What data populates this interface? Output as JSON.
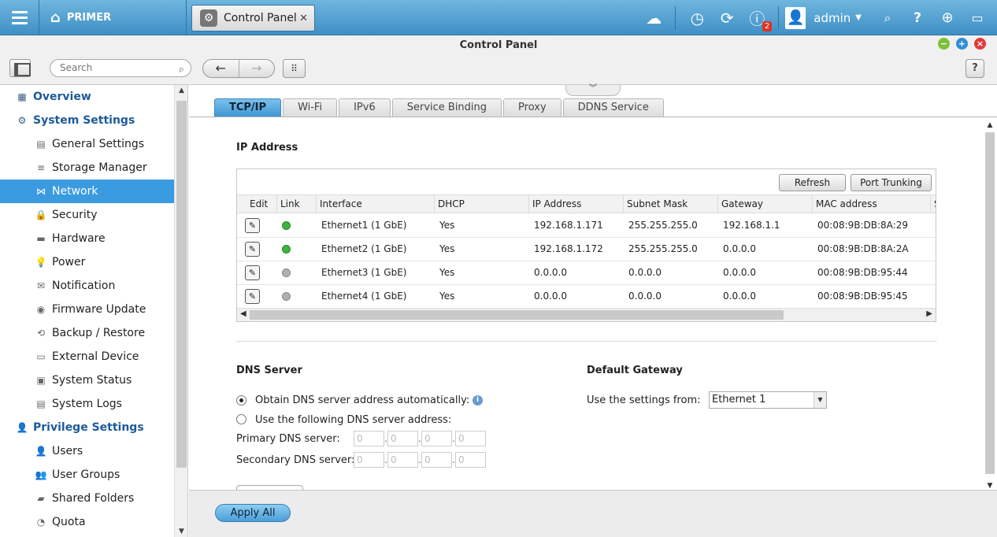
{
  "topbar": {
    "home_label": "PRIMER",
    "tab_title": "Control Panel",
    "tab_close": "✕",
    "user_name": "admin",
    "notification_count": "2"
  },
  "window": {
    "title": "Control Panel"
  },
  "toolbar": {
    "search_placeholder": "Search"
  },
  "sidebar": {
    "items": [
      {
        "label": "Overview",
        "section": true,
        "icon": "grid-icon"
      },
      {
        "label": "System Settings",
        "section": true,
        "icon": "gear-icon"
      },
      {
        "label": "General Settings",
        "icon": "settings-doc-icon"
      },
      {
        "label": "Storage Manager",
        "icon": "storage-icon"
      },
      {
        "label": "Network",
        "icon": "network-icon",
        "active": true
      },
      {
        "label": "Security",
        "icon": "lock-icon"
      },
      {
        "label": "Hardware",
        "icon": "hardware-icon"
      },
      {
        "label": "Power",
        "icon": "power-icon"
      },
      {
        "label": "Notification",
        "icon": "notification-icon"
      },
      {
        "label": "Firmware Update",
        "icon": "firmware-icon"
      },
      {
        "label": "Backup / Restore",
        "icon": "backup-icon"
      },
      {
        "label": "External Device",
        "icon": "external-device-icon"
      },
      {
        "label": "System Status",
        "icon": "monitor-icon"
      },
      {
        "label": "System Logs",
        "icon": "logs-icon"
      },
      {
        "label": "Privilege Settings",
        "section": true,
        "icon": "user-icon"
      },
      {
        "label": "Users",
        "icon": "user-icon"
      },
      {
        "label": "User Groups",
        "icon": "user-group-icon"
      },
      {
        "label": "Shared Folders",
        "icon": "folder-icon"
      },
      {
        "label": "Quota",
        "icon": "quota-icon"
      }
    ]
  },
  "tabs": [
    "TCP/IP",
    "Wi-Fi",
    "IPv6",
    "Service Binding",
    "Proxy",
    "DDNS Service"
  ],
  "ip_section": {
    "title": "IP Address",
    "refresh_label": "Refresh",
    "port_trunking_label": "Port Trunking",
    "columns": [
      "Edit",
      "Link",
      "Interface",
      "DHCP",
      "IP Address",
      "Subnet Mask",
      "Gateway",
      "MAC address",
      "S"
    ],
    "rows": [
      {
        "link": "up",
        "interface": "Ethernet1 (1 GbE)",
        "dhcp": "Yes",
        "ip": "192.168.1.171",
        "mask": "255.255.255.0",
        "gateway": "192.168.1.1",
        "mac": "00:08:9B:DB:8A:29"
      },
      {
        "link": "up",
        "interface": "Ethernet2 (1 GbE)",
        "dhcp": "Yes",
        "ip": "192.168.1.172",
        "mask": "255.255.255.0",
        "gateway": "0.0.0.0",
        "mac": "00:08:9B:DB:8A:2A"
      },
      {
        "link": "down",
        "interface": "Ethernet3 (1 GbE)",
        "dhcp": "Yes",
        "ip": "0.0.0.0",
        "mask": "0.0.0.0",
        "gateway": "0.0.0.0",
        "mac": "00:08:9B:DB:95:44"
      },
      {
        "link": "down",
        "interface": "Ethernet4 (1 GbE)",
        "dhcp": "Yes",
        "ip": "0.0.0.0",
        "mask": "0.0.0.0",
        "gateway": "0.0.0.0",
        "mac": "00:08:9B:DB:95:45"
      }
    ]
  },
  "dns": {
    "title": "DNS Server",
    "auto_label": "Obtain DNS server address automatically:",
    "manual_label": "Use the following DNS server address:",
    "primary_label": "Primary DNS server:",
    "secondary_label": "Secondary DNS server:",
    "octet_placeholder": "0"
  },
  "gateway": {
    "title": "Default Gateway",
    "use_label": "Use the settings from:",
    "selected": "Ethernet 1"
  },
  "footer": {
    "apply_all": "Apply All"
  },
  "colors": {
    "accent": "#3b9be0",
    "link_up": "#3db33d",
    "link_down": "#b0b0b0",
    "section_text": "#1c5a9c"
  }
}
